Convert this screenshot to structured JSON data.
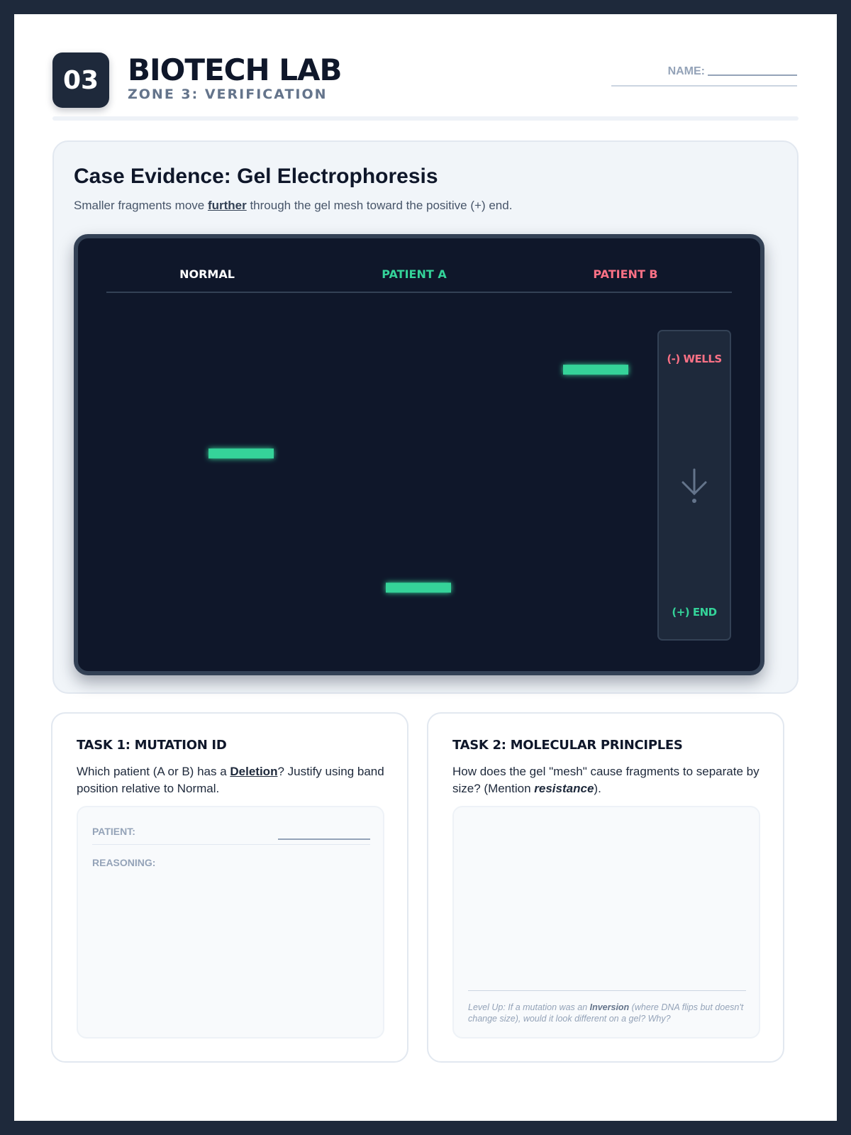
{
  "header": {
    "badge": "03",
    "title": "BIOTECH LAB",
    "subtitle": "ZONE 3: VERIFICATION",
    "name_label": "NAME:"
  },
  "evidence": {
    "title": "Case Evidence: Gel Electrophoresis",
    "desc_before": "Smaller fragments move ",
    "desc_emphasis": "further",
    "desc_after": " through the gel mesh toward the positive (+) end."
  },
  "gel": {
    "lanes": [
      {
        "label": "NORMAL",
        "color": "#ffffff",
        "band_position": 0.45
      },
      {
        "label": "PATIENT A",
        "color": "#34d399",
        "band_position": 0.93
      },
      {
        "label": "PATIENT B",
        "color": "#fb7185",
        "band_position": 0.15
      }
    ],
    "band_color": "#34d399",
    "legend": {
      "top_label": "(-) WELLS",
      "top_color": "#fb7185",
      "bottom_label": "(+) END",
      "bottom_color": "#34d399",
      "icon": "arrow-down-icon"
    }
  },
  "task1": {
    "title": "TASK 1: MUTATION ID",
    "q_before": "Which patient (A or B) has a ",
    "q_emphasis": "Deletion",
    "q_after": "? Justify using band position relative to Normal.",
    "patient_label": "PATIENT:",
    "reasoning_label": "REASONING:"
  },
  "task2": {
    "title": "TASK 2: MOLECULAR PRINCIPLES",
    "q_before": "How does the gel \"mesh\" cause fragments to separate by size? (Mention ",
    "q_emphasis": "resistance",
    "q_after": ").",
    "levelup_before": "Level Up: If a mutation was an ",
    "levelup_emphasis": "Inversion",
    "levelup_after": " (where DNA flips but doesn't change size), would it look different on a gel? Why?"
  }
}
